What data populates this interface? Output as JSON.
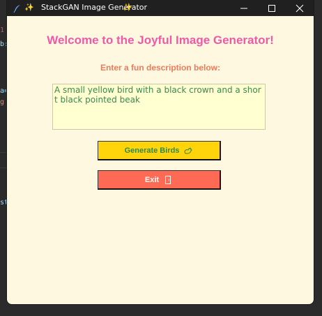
{
  "window": {
    "title": "StackGAN Image Generator",
    "title_prefix_icon": "sparkles-icon",
    "title_suffix_icon": "sparkles-icon",
    "title_sparkle": "✨",
    "controls": [
      "minimize-icon",
      "maximize-icon",
      "close-icon"
    ]
  },
  "main": {
    "heading": "Welcome to the Joyful Image Generator!",
    "subheading": "Enter a fun description below:",
    "description_value": "A small yellow bird with a black crown and a short black pointed beak",
    "generate_label": "Generate Birds",
    "generate_icon": "bird-icon",
    "exit_label": "Exit",
    "exit_icon": "door-icon"
  },
  "colors": {
    "background": "#fff8e1",
    "heading": "#ee5aa6",
    "subheading": "#ee7a5a",
    "input_bg": "#ffffd2",
    "input_text": "#3a8a4a",
    "generate_bg": "#ffd40a",
    "exit_bg": "#ff6a55"
  }
}
